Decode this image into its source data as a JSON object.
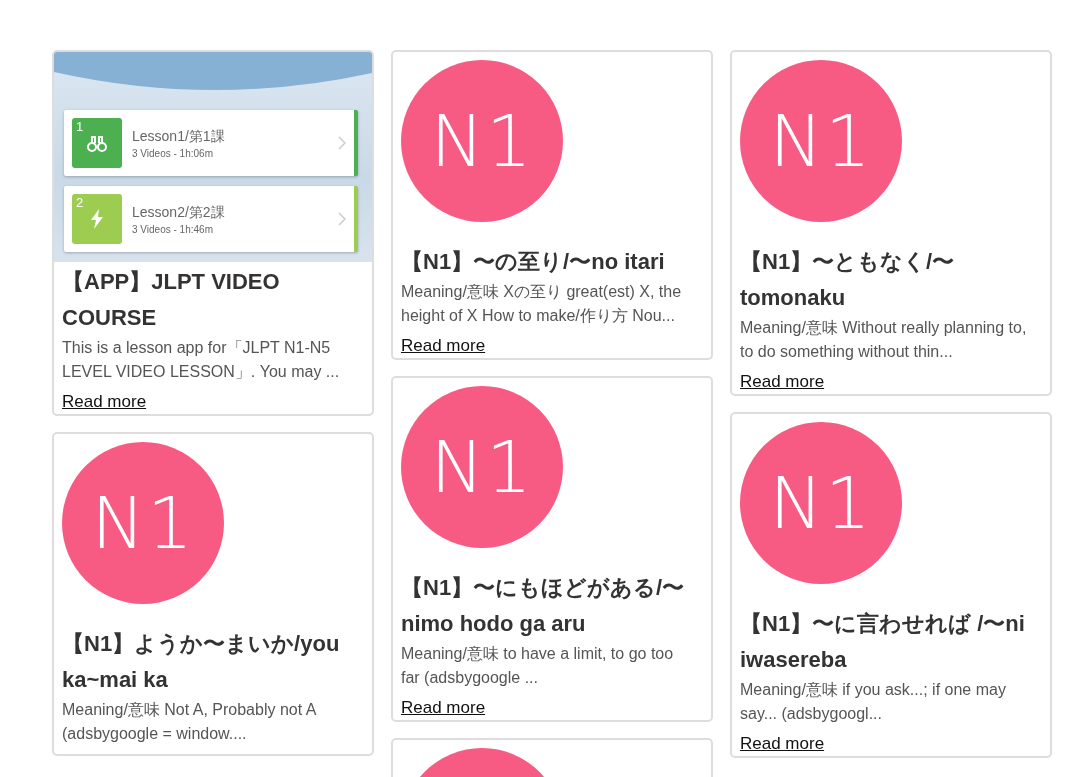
{
  "columns": [
    {
      "cards": [
        {
          "kind": "app",
          "app_preview": {
            "lessons": [
              {
                "number": "1",
                "title": "Lesson1/第1課",
                "meta": "3 Videos -  1h:06m",
                "color": "#4caf50",
                "kind": "binoculars"
              },
              {
                "number": "2",
                "title": "Lesson2/第2課",
                "meta": "3 Videos -  1h:46m",
                "color": "#9ccc50",
                "kind": "bolt"
              }
            ]
          },
          "title": "【APP】JLPT VIDEO COURSE",
          "excerpt": "This is a lesson app for「JLPT N1-N5 LEVEL VIDEO LESSON」. You may ...",
          "link": "Read more"
        },
        {
          "kind": "badge",
          "badge": "N1",
          "title": "【N1】ようか〜まいか/you ka~mai ka",
          "excerpt": "Meaning/意味 Not A, Probably not A (adsbygoogle = window...."
        }
      ]
    },
    {
      "cards": [
        {
          "kind": "badge",
          "badge": "N1",
          "title": "【N1】〜の至り/〜no itari",
          "excerpt": "Meaning/意味 Xの至り great(est) X, the height of X How to make/作り方 Nou...",
          "link": "Read more"
        },
        {
          "kind": "badge",
          "badge": "N1",
          "title": "【N1】〜にもほどがある/〜nimo hodo ga aru",
          "excerpt": "Meaning/意味 to have a limit, to go too far (adsbygoogle ...",
          "link": "Read more"
        },
        {
          "kind": "badge"
        }
      ]
    },
    {
      "cards": [
        {
          "kind": "badge",
          "badge": "N1",
          "title": "【N1】〜ともなく/〜tomonaku",
          "excerpt": "Meaning/意味 Without really planning to, to do something without thin...",
          "link": "Read more"
        },
        {
          "kind": "badge",
          "badge": "N1",
          "title": "【N1】〜に言わせれば /〜ni iwasereba",
          "excerpt": "Meaning/意味 if you ask...; if one may say... (adsbygoogl...",
          "link": "Read more"
        }
      ]
    }
  ]
}
